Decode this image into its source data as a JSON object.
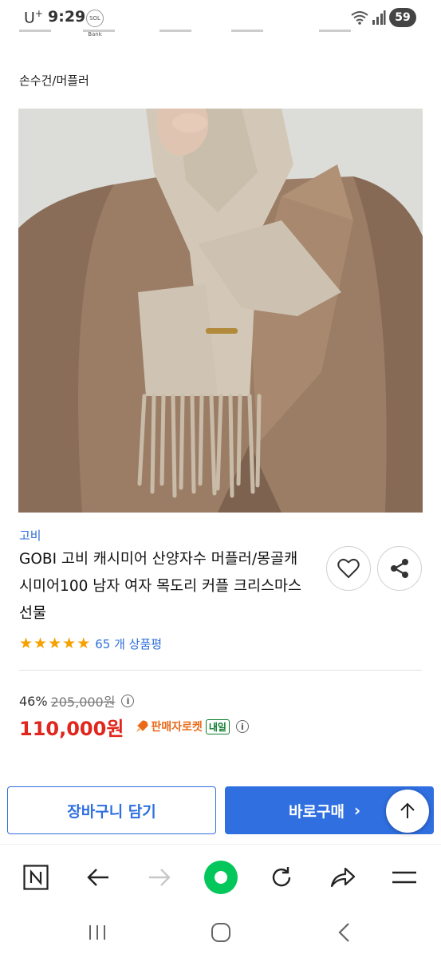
{
  "status_bar": {
    "carrier": "U",
    "carrier_sup": "+",
    "time": "9:29",
    "sol_badge": "SOL Bank",
    "battery": "59"
  },
  "breadcrumb": "손수건/머플러",
  "product": {
    "brand": "고비",
    "title": "GOBI 고비 캐시미어 산양자수 머플러/몽골캐시미어100 남자 여자 목도리 커플 크리스마스 선물",
    "rating_stars": 5,
    "review_count_text": "65 개 상품평",
    "discount_percent": "46%",
    "original_price": "205,000원",
    "sale_price": "110,000원",
    "delivery_badge": "판매자로켓",
    "delivery_day": "내일"
  },
  "actions": {
    "cart_label": "장바구니 담기",
    "buy_label": "바로구매",
    "buy_chevron": "›"
  },
  "icons": {
    "favorite": "heart-icon",
    "share": "share-icon",
    "scroll_top": "arrow-up-icon",
    "info": "info-icon"
  },
  "colors": {
    "accent": "#2f6fe0",
    "price": "#e0261d",
    "star": "#f5a100",
    "naver_green": "#03c75a"
  }
}
